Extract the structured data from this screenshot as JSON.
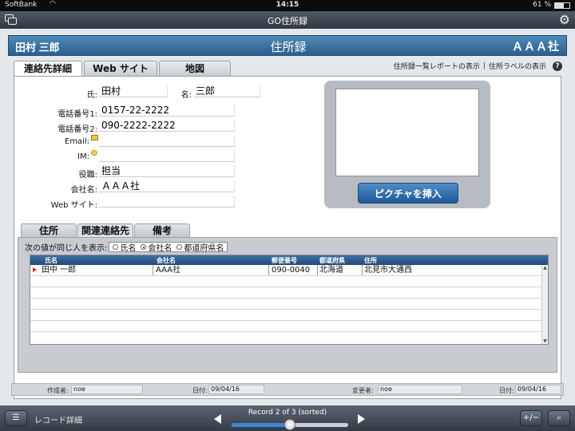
{
  "status": {
    "carrier": "SoftBank",
    "time": "14:15",
    "battery": "61 %",
    "battery_level": 0.61
  },
  "appbar": {
    "title": "GO住所録",
    "icons": [
      "window-icon",
      "gear-icon"
    ]
  },
  "header": {
    "name": "田村 三郎",
    "title": "住所録",
    "company": "ＡＡＡ社"
  },
  "links": {
    "report": "住所録一覧レポートの表示",
    "labels": "住所ラベルの表示",
    "help": "?"
  },
  "tabs": [
    "連絡先詳細",
    "Web サイト",
    "地図"
  ],
  "fields": {
    "last_name_label": "氏:",
    "last_name": "田村",
    "first_name_label": "名:",
    "first_name": "三郎",
    "phone1_label": "電話番号1:",
    "phone1": "0157-22-2222",
    "phone2_label": "電話番号2:",
    "phone2": "090-2222-2222",
    "email_label": "Email:",
    "email": "",
    "im_label": "IM:",
    "im": "",
    "role_label": "役職:",
    "role": "担当",
    "company_label": "会社名:",
    "company": "ＡＡＡ社",
    "website_label": "Web サイト:",
    "website": ""
  },
  "picture": {
    "button": "ピクチャを挿入"
  },
  "subtabs": [
    "住所",
    "関連連絡先",
    "備考"
  ],
  "related": {
    "filter_label": "次の値が同じ人を表示:",
    "options": [
      "氏名",
      "会社名",
      "都道府県名"
    ],
    "selected": "会社名",
    "columns": [
      "氏名",
      "会社名",
      "郵便番号",
      "都道府県",
      "住所"
    ],
    "rows": [
      [
        "田中 一郎",
        "AAA社",
        "090-0040",
        "北海道",
        "北見市大通西"
      ]
    ]
  },
  "meta": {
    "creator_label": "作成者:",
    "creator": "noe",
    "created_date_label": "日付:",
    "created_date": "09/04/16",
    "modifier_label": "変更者:",
    "modifier": "noe",
    "modified_date_label": "日付:",
    "modified_date": "09/04/16"
  },
  "toolbar": {
    "mode": "レコード詳細",
    "record": "Record 2 of 3 (sorted)",
    "progress": 0.5
  },
  "colors": {
    "header": "#2b5f8e",
    "button": "#1f5896",
    "status_bar": "#0b0b0b"
  }
}
